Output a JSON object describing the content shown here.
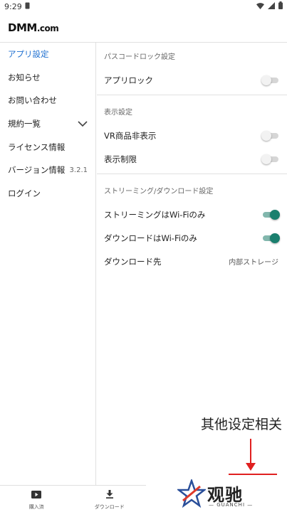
{
  "status_bar": {
    "time": "9:29"
  },
  "header": {
    "logo_main": "DMM",
    "logo_suffix": ".com"
  },
  "sidebar": {
    "items": [
      {
        "label": "アプリ設定",
        "active": true
      },
      {
        "label": "お知らせ"
      },
      {
        "label": "お問い合わせ"
      },
      {
        "label": "規約一覧"
      },
      {
        "label": "ライセンス情報"
      },
      {
        "label": "バージョン情報",
        "value": "3.2.1"
      },
      {
        "label": "ログイン"
      }
    ]
  },
  "content": {
    "sections": [
      {
        "title": "パスコードロック設定",
        "rows": [
          {
            "label": "アプリロック",
            "toggle": false
          }
        ]
      },
      {
        "title": "表示設定",
        "rows": [
          {
            "label": "VR商品非表示",
            "toggle": false
          },
          {
            "label": "表示制限",
            "toggle": false
          }
        ]
      },
      {
        "title": "ストリーミング/ダウンロード設定",
        "rows": [
          {
            "label": "ストリーミングはWi-Fiのみ",
            "toggle": true
          },
          {
            "label": "ダウンロードはWi-Fiのみ",
            "toggle": true
          },
          {
            "label": "ダウンロード先",
            "value": "内部ストレージ"
          }
        ]
      }
    ]
  },
  "bottom_nav": {
    "items": [
      {
        "label": "購入済",
        "icon": "play-icon"
      },
      {
        "label": "ダウンロード",
        "icon": "download-icon"
      }
    ]
  },
  "annotation": {
    "text": "其他设定相关"
  },
  "watermark": {
    "text": "观驰",
    "sub": "— GUANCHI —"
  },
  "colors": {
    "accent_blue": "#1e6fd0",
    "toggle_on": "#1a7f6e",
    "arrow_red": "#e02020"
  }
}
